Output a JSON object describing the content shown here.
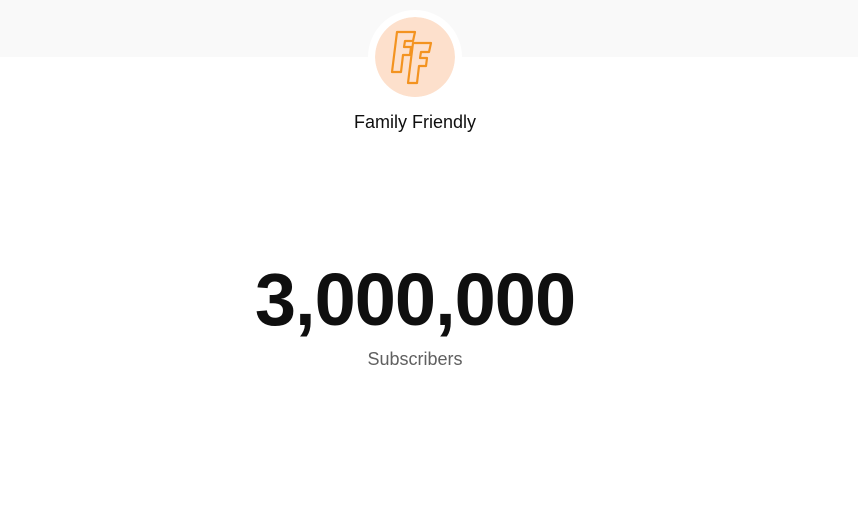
{
  "channel": {
    "name": "Family Friendly",
    "avatar_icon": "ff-logo-icon",
    "avatar_text": "FF",
    "avatar_background": "#fde0cc",
    "logo_color": "#f39320"
  },
  "stats": {
    "subscriber_count": "3,000,000",
    "subscriber_label": "Subscribers"
  },
  "colors": {
    "top_band": "#f9f9f9",
    "count_text": "#0f0f0f",
    "label_text": "#606060"
  }
}
